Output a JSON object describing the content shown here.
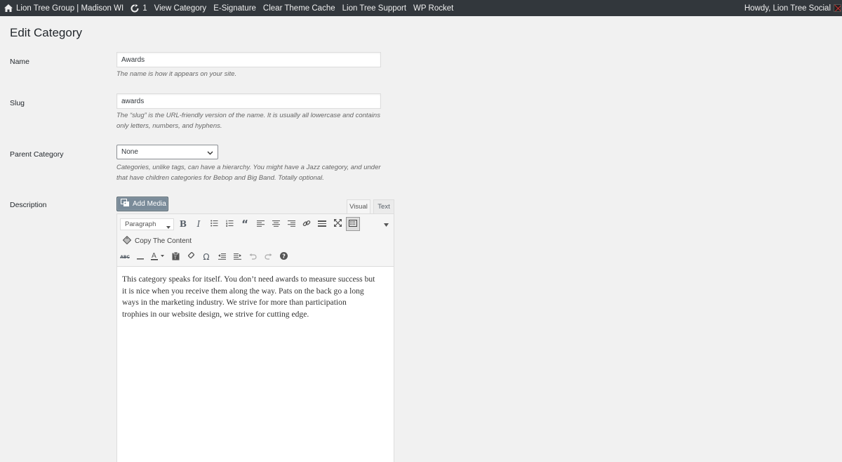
{
  "adminbar": {
    "site_name": "Lion Tree Group | Madison WI",
    "updates_count": "1",
    "menu": [
      "View Category",
      "E-Signature",
      "Clear Theme Cache",
      "Lion Tree Support",
      "WP Rocket"
    ],
    "greeting": "Howdy, Lion Tree Social"
  },
  "page": {
    "title": "Edit Category"
  },
  "form": {
    "name": {
      "label": "Name",
      "value": "Awards",
      "description": "The name is how it appears on your site."
    },
    "slug": {
      "label": "Slug",
      "value": "awards",
      "description_line1": "The “slug” is the URL-friendly version of the name. It is usually all lowercase and contains",
      "description_line2": "only letters, numbers, and hyphens."
    },
    "parent": {
      "label": "Parent Category",
      "value": "None",
      "description_line1": "Categories, unlike tags, can have a hierarchy. You might have a Jazz category, and under",
      "description_line2": "that have children categories for Bebop and Big Band. Totally optional."
    },
    "description": {
      "label": "Description",
      "add_media_label": "Add Media",
      "tabs": [
        "Visual",
        "Text"
      ],
      "format_select": "Paragraph",
      "copy_content_label": "Copy The Content",
      "content_lines": [
        "This category speaks for itself.  You don’t need awards to measure success but",
        "it is nice when you receive them along the way.  Pats on the back go a long",
        "ways in the marketing industry. We strive for more than participation",
        "trophies in our website design, we strive for cutting edge."
      ]
    }
  },
  "colors": {
    "adminbar_bg": "#32373c",
    "page_bg": "#f1f1f1",
    "add_media_bg": "#7a8b99"
  }
}
